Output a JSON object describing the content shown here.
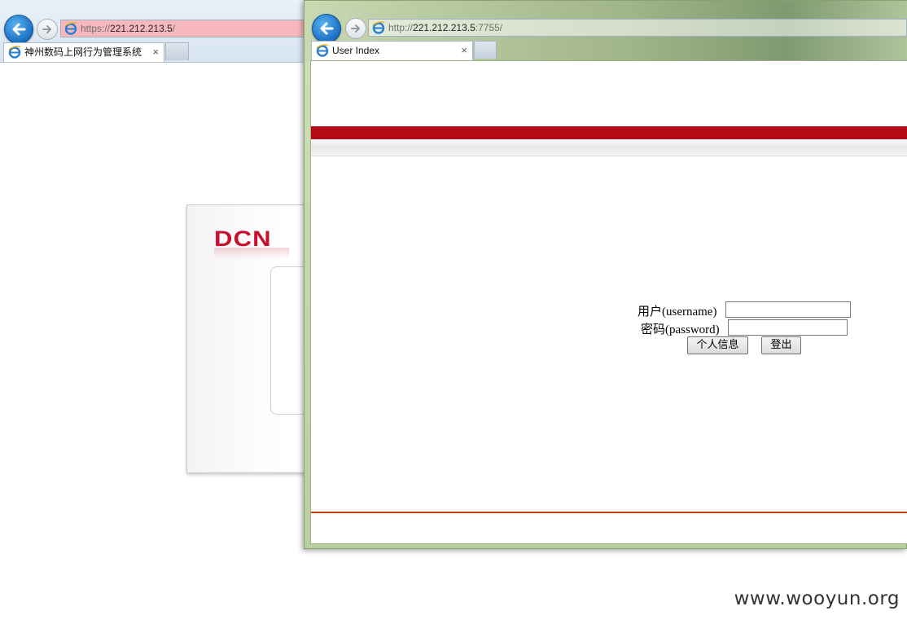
{
  "back_window": {
    "address": {
      "scheme": "https://",
      "host": "221.212.213.5",
      "path": "/"
    },
    "tab": {
      "label": "神州数码上网行为管理系统",
      "close": "×"
    },
    "logo_text": "DCN"
  },
  "front_window": {
    "address": {
      "scheme": "http://",
      "host": "221.212.213.5",
      "path": ":7755/"
    },
    "tab": {
      "label": "User Index",
      "close": "×"
    },
    "form": {
      "username_label": "用户(username)",
      "password_label": "密码(password)",
      "username_value": "",
      "password_value": "",
      "profile_button": "个人信息",
      "logout_button": "登出"
    }
  },
  "watermark": "www.wooyun.org",
  "colors": {
    "brand_red": "#c8102e",
    "banner_red": "#b40a16",
    "address_highlight": "#f7b8bd"
  }
}
